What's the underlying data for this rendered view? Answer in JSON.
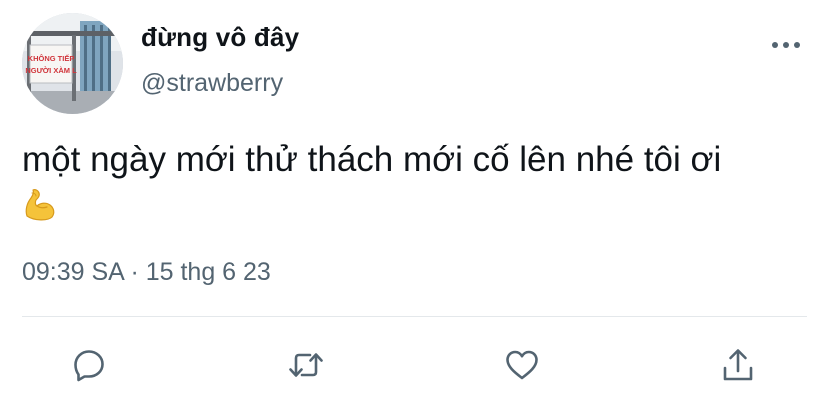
{
  "tweet": {
    "display_name": "đừng vô đây",
    "handle": "@strawberry",
    "text": "một ngày mới thử thách mới cố lên nhé tôi ơi",
    "emoji": "💪",
    "time": "09:39 SA",
    "separator": "·",
    "date": "15 thg 6 23"
  },
  "avatar": {
    "sign_line_1": "KHÔNG TIẾP",
    "sign_line_2": "NGƯỜI XÀM L"
  },
  "icons": {
    "more": "more-horizontal-icon",
    "reply": "reply-icon",
    "retweet": "retweet-icon",
    "like": "heart-icon",
    "share": "share-icon"
  },
  "colors": {
    "text": "#0f1419",
    "secondary": "#536471",
    "divider": "#e4e8eb",
    "sign_red": "#d0343a"
  }
}
